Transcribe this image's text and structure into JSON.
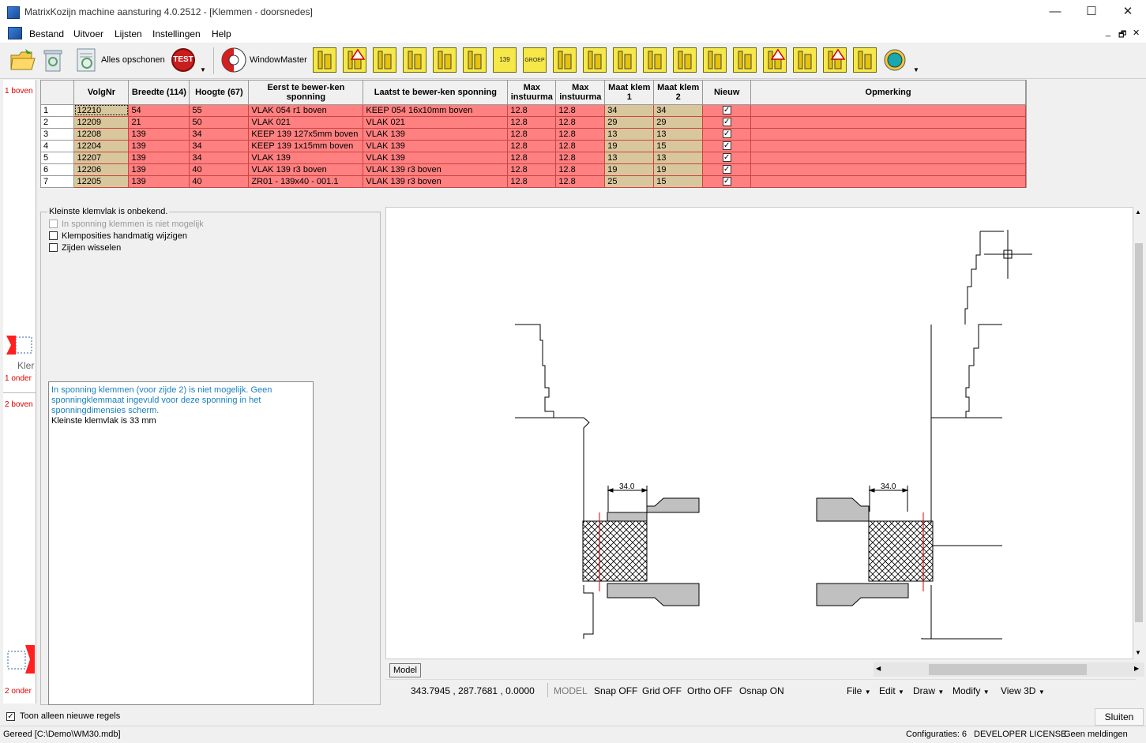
{
  "window": {
    "title": "MatrixKozijn machine aansturing 4.0.2512 - [Klemmen - doorsnedes]",
    "minimize": "—",
    "maximize": "☐",
    "close": "✕"
  },
  "menu": [
    "Bestand",
    "Uitvoer",
    "Lijsten",
    "Instellingen",
    "Help"
  ],
  "mdi_controls": [
    "_",
    "🗗",
    "✕"
  ],
  "toolbar": {
    "clear_label": "Alles opschonen",
    "test_label": "TEST",
    "windowmaster_label": "WindowMaster",
    "tool_icons": [
      "profile-L-icon",
      "warning-profile-icon",
      "profile-W-icon",
      "profile-clamp-icon",
      "profile-cross-icon",
      "profile-roof-icon",
      "profile-139-icon",
      "profile-group-icon",
      "profile-house-icon",
      "profile-c-icon",
      "profile-w2-icon",
      "profile-tree-icon",
      "profile-t-icon",
      "profile-io-icon",
      "profile-stripes-icon",
      "profile-warn2-icon",
      "profile-box-icon",
      "profile-warn3-icon",
      "profile-s-icon",
      "profile-circle-icon"
    ],
    "group_caption": "GROEP",
    "label_139": "139"
  },
  "left_strip": {
    "labels": [
      "1 boven",
      "1 onder",
      "2 boven",
      "2 onder"
    ],
    "partial_text": "Kler"
  },
  "grid": {
    "headers": [
      "",
      "VolgNr",
      "Breedte (114)",
      "Hoogte (67)",
      "Eerst te bewer-ken sponning",
      "Laatst te bewer-ken sponning",
      "Max instuurma",
      "Max instuurma",
      "Maat klem 1",
      "Maat klem 2",
      "Nieuw",
      "Opmerking"
    ],
    "rows": [
      [
        "1",
        "12210",
        "54",
        "55",
        "VLAK 054 r1 boven",
        "KEEP 054 16x10mm boven",
        "12.8",
        "12.8",
        "34",
        "34",
        true,
        ""
      ],
      [
        "2",
        "12209",
        "21",
        "50",
        "VLAK 021",
        "VLAK 021",
        "12.8",
        "12.8",
        "29",
        "29",
        true,
        ""
      ],
      [
        "3",
        "12208",
        "139",
        "34",
        "KEEP 139 127x5mm boven",
        "VLAK 139",
        "12.8",
        "12.8",
        "13",
        "13",
        true,
        ""
      ],
      [
        "4",
        "12204",
        "139",
        "34",
        "KEEP 139 1x15mm boven",
        "VLAK 139",
        "12.8",
        "12.8",
        "19",
        "15",
        true,
        ""
      ],
      [
        "5",
        "12207",
        "139",
        "34",
        "VLAK 139",
        "VLAK 139",
        "12.8",
        "12.8",
        "13",
        "13",
        true,
        ""
      ],
      [
        "6",
        "12206",
        "139",
        "40",
        "VLAK 139 r3 boven",
        "VLAK 139 r3 boven",
        "12.8",
        "12.8",
        "19",
        "19",
        true,
        ""
      ],
      [
        "7",
        "12205",
        "139",
        "40",
        "ZR01 - 139x40 - 001.1",
        "VLAK 139 r3 boven",
        "12.8",
        "12.8",
        "25",
        "15",
        true,
        ""
      ]
    ]
  },
  "options": {
    "group_label": "Kleinste klemvlak is onbekend.",
    "items": [
      "In sponning klemmen is niet mogelijk",
      "Klemposities handmatig wijzigen",
      "Zijden wisselen"
    ]
  },
  "messages": {
    "line1": "In sponning klemmen (voor zijde 2) is niet mogelijk. Geen sponningklemmaat ingevuld voor deze sponning in het sponningdimensies scherm.",
    "line2": "Kleinste klemvlak is 33 mm"
  },
  "cad": {
    "dim_left": "34.0",
    "dim_right": "34.0",
    "model_tab": "Model",
    "coords": "343.7945 , 287.7681 , 0.0000",
    "mode": "MODEL",
    "toggles": [
      "Snap OFF",
      "Grid OFF",
      "Ortho OFF",
      "Osnap ON"
    ],
    "menus": [
      "File",
      "Edit",
      "Draw",
      "Modify",
      "View 3D"
    ]
  },
  "bottom": {
    "show_new_only": "Toon alleen nieuwe regels",
    "close_button": "Sluiten"
  },
  "status": {
    "left": "Gereed [C:\\Demo\\WM30.mdb]",
    "configs": "Configuraties: 6",
    "license": "DEVELOPER LICENSE",
    "notices": "Geen meldingen"
  }
}
